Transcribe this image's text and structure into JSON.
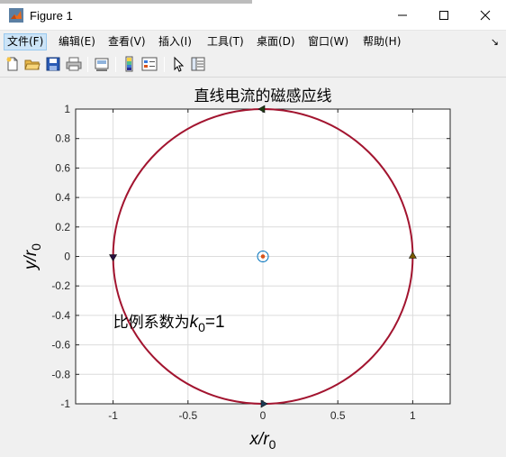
{
  "window": {
    "title": "Figure 1",
    "minimize_glyph": "—",
    "maximize_glyph": "☐",
    "close_glyph": "✕"
  },
  "menu": {
    "items": [
      "文件(F)",
      "编辑(E)",
      "查看(V)",
      "插入(I)",
      "工具(T)",
      "桌面(D)",
      "窗口(W)",
      "帮助(H)"
    ],
    "overflow_glyph": "↘"
  },
  "toolbar": {
    "icons": [
      "new-figure-icon",
      "open-file-icon",
      "save-icon",
      "print-icon",
      "link-plot-icon",
      "colorbar-icon",
      "legend-icon",
      "pointer-icon",
      "property-editor-icon"
    ]
  },
  "colors": {
    "curve": "#a2142f",
    "grid": "#dcdcdc",
    "axes": "#262626",
    "center_ring": "#0072bd",
    "center_dot": "#d95319",
    "arrow_top": "#1f3b10",
    "arrow_left": "#2a1040",
    "arrow_right": "#7a5a00",
    "arrow_bottom": "#1a3a55"
  },
  "chart_data": {
    "type": "line",
    "title": "直线电流的磁感应线",
    "xlabel": "x/r",
    "xlabel_sub": "0",
    "ylabel": "y/r",
    "ylabel_sub": "0",
    "xlim": [
      -1.25,
      1.25
    ],
    "ylim": [
      -1,
      1
    ],
    "xticks": [
      -1,
      -0.5,
      0,
      0.5,
      1
    ],
    "xtick_labels": [
      "-1",
      "-0.5",
      "0",
      "0.5",
      "1"
    ],
    "yticks": [
      1,
      0.8,
      0.6,
      0.4,
      0.2,
      0,
      -0.2,
      -0.4,
      -0.6,
      -0.8,
      -1
    ],
    "ytick_labels": [
      "1",
      "0.8",
      "0.6",
      "0.4",
      "0.2",
      "0",
      "-0.2",
      "-0.4",
      "-0.6",
      "-0.8",
      "-1"
    ],
    "grid": true,
    "series": [
      {
        "kind": "circle",
        "center": [
          0,
          0
        ],
        "radius": 1
      }
    ],
    "arrows": [
      {
        "x": 0,
        "y": 1,
        "direction": "left"
      },
      {
        "x": -1,
        "y": 0,
        "direction": "down"
      },
      {
        "x": 0,
        "y": -1,
        "direction": "right"
      },
      {
        "x": 1,
        "y": 0,
        "direction": "up"
      }
    ],
    "center_marker": {
      "x": 0,
      "y": 0
    },
    "annotation": {
      "text_prefix": "比例系数为",
      "symbol": "k",
      "sub": "0",
      "suffix": "=1",
      "x": -1,
      "y": -0.48
    }
  }
}
